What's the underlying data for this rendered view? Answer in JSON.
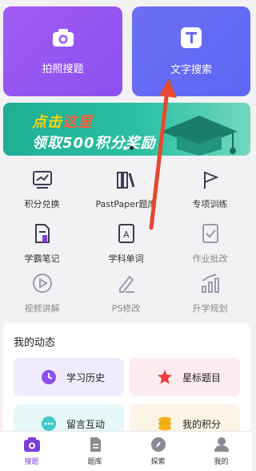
{
  "top_cards": {
    "photo_label": "拍照搜题",
    "text_label": "文字搜索"
  },
  "banner": {
    "line1_part1": "点击",
    "line1_part2": "这里",
    "line2": "领取500积分奖励"
  },
  "grid": [
    {
      "label": "积分兑换",
      "icon": "chart-board-icon"
    },
    {
      "label": "PastPaper题库",
      "icon": "books-icon"
    },
    {
      "label": "专项训练",
      "icon": "flag-icon"
    },
    {
      "label": "学霸笔记",
      "icon": "notes-icon"
    },
    {
      "label": "学科单词",
      "icon": "dictionary-icon"
    },
    {
      "label": "作业批改",
      "icon": "checklist-icon"
    },
    {
      "label": "视频讲解",
      "icon": "play-icon"
    },
    {
      "label": "PS修改",
      "icon": "edit-pen-icon"
    },
    {
      "label": "升学规划",
      "icon": "growth-chart-icon"
    }
  ],
  "dynamics": {
    "title": "我的动态",
    "tiles": [
      {
        "label": "学习历史",
        "icon": "clock-icon"
      },
      {
        "label": "星标题目",
        "icon": "star-icon"
      },
      {
        "label": "留言互动",
        "icon": "chat-icon"
      },
      {
        "label": "我的积分",
        "icon": "coins-icon"
      }
    ]
  },
  "tabbar": [
    {
      "label": "搜题",
      "icon": "camera-icon",
      "active": true
    },
    {
      "label": "题库",
      "icon": "document-icon",
      "active": false
    },
    {
      "label": "探索",
      "icon": "compass-icon",
      "active": false
    },
    {
      "label": "我的",
      "icon": "profile-icon",
      "active": false
    }
  ],
  "colors": {
    "accent": "#7b3fd8",
    "photo_card": "#9a57f1",
    "text_card": "#6468f4",
    "banner": "#2bc0a2",
    "annotation_arrow": "#e5492f"
  }
}
